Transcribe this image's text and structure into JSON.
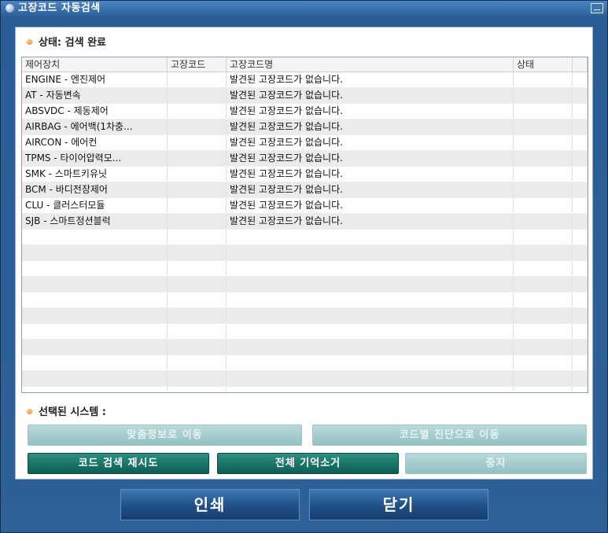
{
  "window": {
    "title": "고장코드 자동검색"
  },
  "status": {
    "label": "상태: 검색 완료"
  },
  "table": {
    "columns": [
      "제어장치",
      "고장코드",
      "고장코드명",
      "상태"
    ],
    "rows": [
      {
        "device": "ENGINE - 엔진제어",
        "code": "",
        "name": "발견된 고장코드가 없습니다.",
        "state": ""
      },
      {
        "device": "AT - 자동변속",
        "code": "",
        "name": "발견된 고장코드가 없습니다.",
        "state": ""
      },
      {
        "device": "ABSVDC - 제동제어",
        "code": "",
        "name": "발견된 고장코드가 없습니다.",
        "state": ""
      },
      {
        "device": "AIRBAG - 에어백(1차충...",
        "code": "",
        "name": "발견된 고장코드가 없습니다.",
        "state": ""
      },
      {
        "device": "AIRCON - 에어컨",
        "code": "",
        "name": "발견된 고장코드가 없습니다.",
        "state": ""
      },
      {
        "device": "TPMS - 타이어압력모...",
        "code": "",
        "name": "발견된 고장코드가 없습니다.",
        "state": ""
      },
      {
        "device": "SMK - 스마트키유닛",
        "code": "",
        "name": "발견된 고장코드가 없습니다.",
        "state": ""
      },
      {
        "device": "BCM - 바디전장제어",
        "code": "",
        "name": "발견된 고장코드가 없습니다.",
        "state": ""
      },
      {
        "device": "CLU - 클러스터모듈",
        "code": "",
        "name": "발견된 고장코드가 없습니다.",
        "state": ""
      },
      {
        "device": "SJB - 스마트정션블럭",
        "code": "",
        "name": "발견된 고장코드가 없습니다.",
        "state": ""
      },
      {
        "device": "",
        "code": "",
        "name": "",
        "state": ""
      },
      {
        "device": "",
        "code": "",
        "name": "",
        "state": ""
      },
      {
        "device": "",
        "code": "",
        "name": "",
        "state": ""
      },
      {
        "device": "",
        "code": "",
        "name": "",
        "state": ""
      },
      {
        "device": "",
        "code": "",
        "name": "",
        "state": ""
      },
      {
        "device": "",
        "code": "",
        "name": "",
        "state": ""
      },
      {
        "device": "",
        "code": "",
        "name": "",
        "state": ""
      },
      {
        "device": "",
        "code": "",
        "name": "",
        "state": ""
      },
      {
        "device": "",
        "code": "",
        "name": "",
        "state": ""
      },
      {
        "device": "",
        "code": "",
        "name": "",
        "state": ""
      },
      {
        "device": "",
        "code": "",
        "name": "",
        "state": ""
      }
    ]
  },
  "selected": {
    "label": "선택된 시스템 :"
  },
  "buttons": {
    "go_custom_info": "맞춤정보로 이동",
    "go_code_diagnosis": "코드별 진단으로 이동",
    "retry_search": "코드 검색 재시도",
    "clear_all_memory": "전체 기억소거",
    "stop": "중지",
    "print": "인쇄",
    "close": "닫기"
  },
  "colors": {
    "window_bg": "#2f5a8c",
    "button_enabled": "#136d63",
    "button_disabled": "#a9cfd0",
    "bullet": "#f07a10"
  }
}
